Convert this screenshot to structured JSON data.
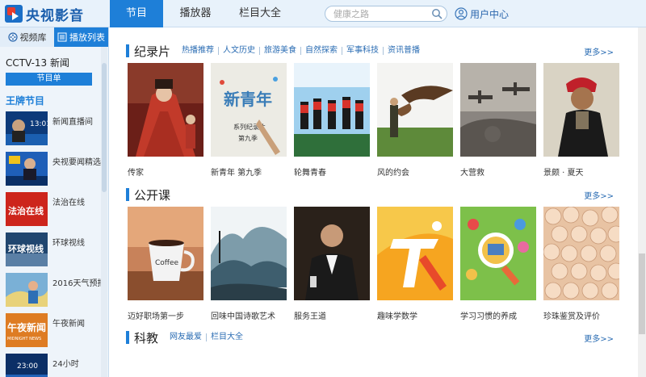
{
  "app": {
    "logo_text": "央视影音"
  },
  "tabs": [
    {
      "label": "节目",
      "active": true
    },
    {
      "label": "播放器",
      "active": false
    },
    {
      "label": "栏目大全",
      "active": false
    }
  ],
  "search": {
    "placeholder": "健康之路"
  },
  "user": {
    "label": "用户中心"
  },
  "sidebar": {
    "tabs": [
      {
        "label": "视频库",
        "icon": "film-icon",
        "active": false
      },
      {
        "label": "播放列表",
        "icon": "list-icon",
        "active": true
      }
    ],
    "channel": "CCTV-13 新闻",
    "program_button": "节目单",
    "heading": "王牌节目",
    "items": [
      {
        "label": "新闻直播间"
      },
      {
        "label": "央视要闻精选"
      },
      {
        "label": "法治在线"
      },
      {
        "label": "环球视线"
      },
      {
        "label": "2016天气预报"
      },
      {
        "label": "午夜新闻"
      },
      {
        "label": "24小时"
      }
    ]
  },
  "sections": [
    {
      "title": "纪录片",
      "links": [
        "热播推荐",
        "人文历史",
        "旅游美食",
        "自然探索",
        "军事科技",
        "资讯普播"
      ],
      "more": "更多>>",
      "cards": [
        {
          "caption": "传家"
        },
        {
          "caption": "新青年 第九季"
        },
        {
          "caption": "轮舞青春"
        },
        {
          "caption": "风的约会"
        },
        {
          "caption": "大营救"
        },
        {
          "caption": "景颇 · 夏天"
        }
      ]
    },
    {
      "title": "公开课",
      "links": [],
      "more": "更多>>",
      "cards": [
        {
          "caption": "迈好职场第一步"
        },
        {
          "caption": "回味中国诗歌艺术"
        },
        {
          "caption": "服务王道"
        },
        {
          "caption": "趣味学数学"
        },
        {
          "caption": "学习习惯的养成"
        },
        {
          "caption": "珍珠鉴赏及评价"
        }
      ]
    },
    {
      "title": "科教",
      "links": [
        "网友最爱",
        "栏目大全"
      ],
      "more": "更多>>",
      "cards": []
    }
  ],
  "thumb_texts": {
    "poster_title": "新青年",
    "poster_sub": "系列纪录片",
    "poster_season": "第九季",
    "cup_text": "Coffee",
    "side_fazhi": "法治在线",
    "side_huanqiu": "环球视线",
    "side_wuye": "午夜新闻",
    "side_wuye_en": "MIDNIGHT NEWS",
    "side_clock1": "13:01",
    "side_clock2": "23:00"
  }
}
